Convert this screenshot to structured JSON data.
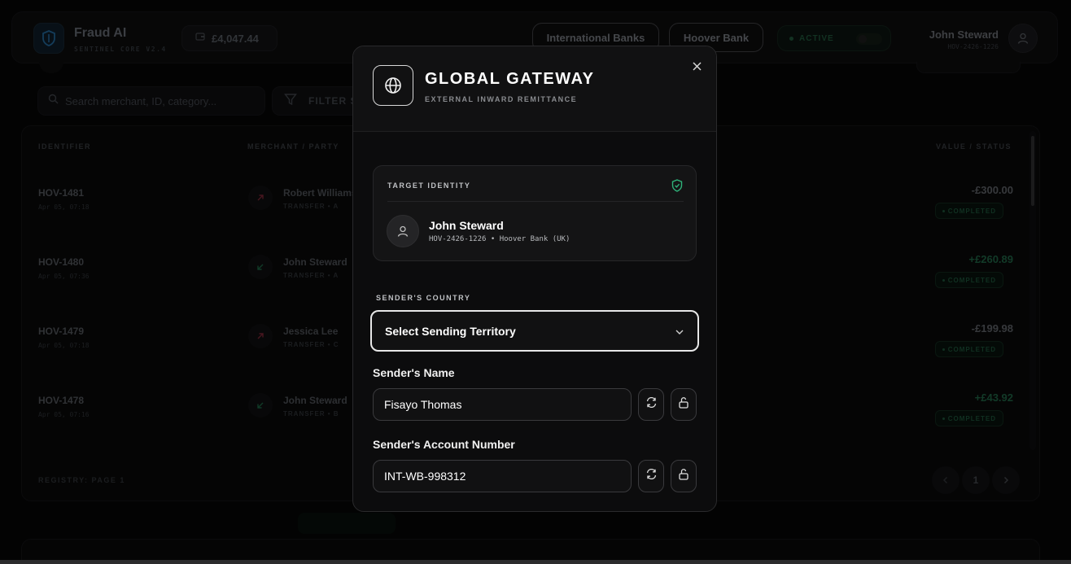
{
  "header": {
    "brand_title": "Fraud AI",
    "brand_subtitle": "SENTINEL CORE V2.4",
    "balance": "£4,047.44",
    "btn_international": "International Banks",
    "btn_hoover": "Hoover Bank",
    "status_label": "ACTIVE",
    "user_name": "John Steward",
    "user_id": "HOV-2426-1226"
  },
  "toolbar": {
    "search_placeholder": "Search merchant, ID, category...",
    "filter_label": "FILTER S"
  },
  "table": {
    "columns": {
      "identifier": "IDENTIFIER",
      "merchant": "MERCHANT / PARTY",
      "value": "VALUE / STATUS"
    },
    "rows": [
      {
        "id": "HOV-1481",
        "date": "Apr 05, 07:18",
        "merchant": "Robert Williams",
        "type": "TRANSFER • A",
        "value": "-£300.00",
        "status": "COMPLETED",
        "direction": "out"
      },
      {
        "id": "HOV-1480",
        "date": "Apr 05, 07:36",
        "merchant": "John Steward",
        "type": "TRANSFER • A",
        "value": "+£260.89",
        "status": "COMPLETED",
        "direction": "in"
      },
      {
        "id": "HOV-1479",
        "date": "Apr 05, 07:18",
        "merchant": "Jessica Lee",
        "type": "TRANSFER • C",
        "value": "-£199.98",
        "status": "COMPLETED",
        "direction": "out"
      },
      {
        "id": "HOV-1478",
        "date": "Apr 05, 07:16",
        "merchant": "John Steward",
        "type": "TRANSFER • B",
        "value": "+£43.92",
        "status": "COMPLETED",
        "direction": "in"
      }
    ],
    "registry": "REGISTRY: PAGE 1",
    "page_number": "1"
  },
  "modal": {
    "title": "GLOBAL GATEWAY",
    "subtitle": "EXTERNAL INWARD REMITTANCE",
    "identity": {
      "label": "TARGET IDENTITY",
      "name": "John Steward",
      "meta": "HOV-2426-1226 • Hoover Bank (UK)"
    },
    "country_label": "SENDER'S COUNTRY",
    "country_value": "Select Sending Territory",
    "name_label": "Sender's Name",
    "name_value": "Fisayo Thomas",
    "account_label": "Sender's Account Number",
    "account_value": "INT-WB-998312"
  },
  "colors": {
    "accent_green": "#1f8a5c",
    "negative_red": "#8a2a3a",
    "shield_green": "#2fb37a"
  }
}
